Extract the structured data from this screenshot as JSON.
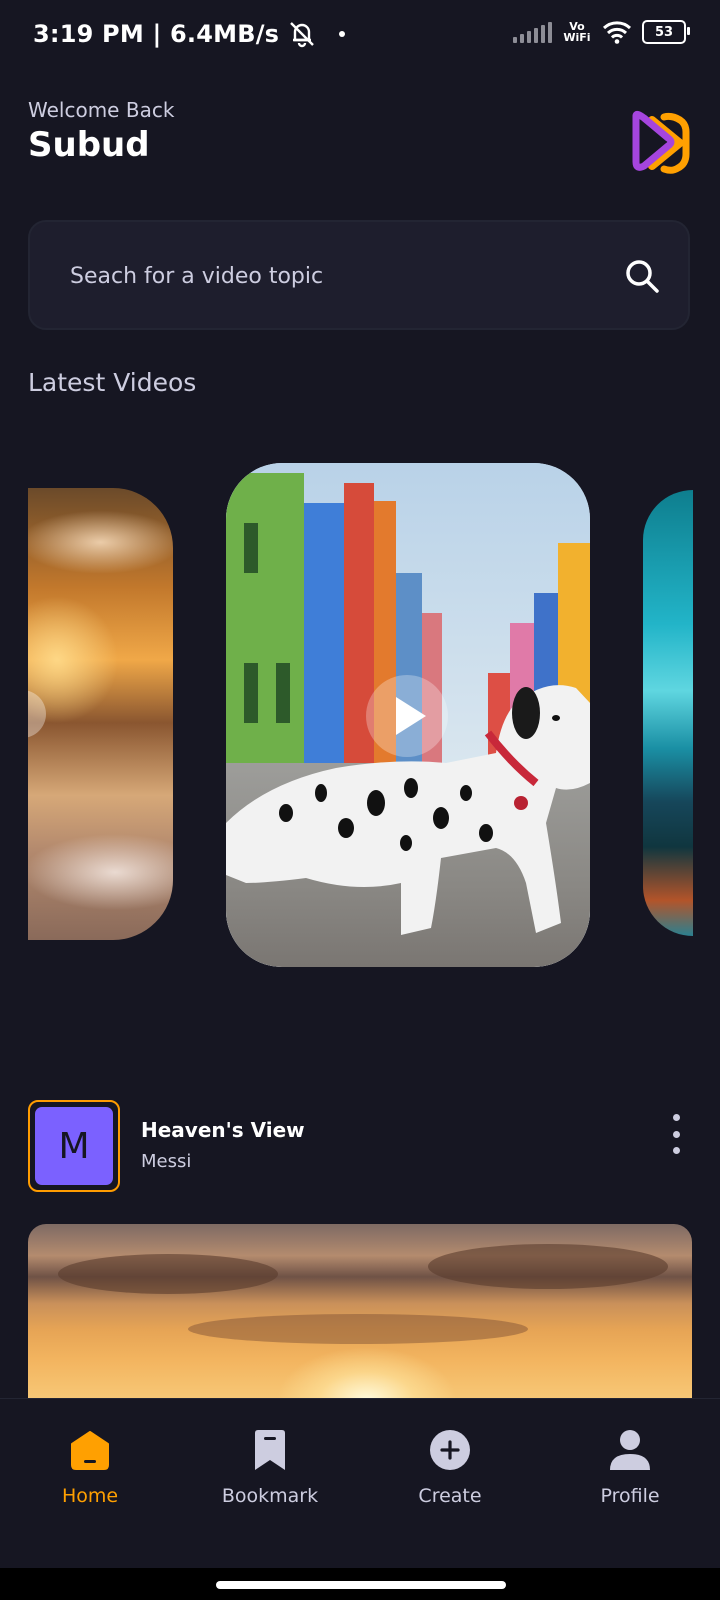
{
  "status_bar": {
    "time_speed": "3:19 PM | 6.4MB/s",
    "network": "Vo WiFi",
    "battery": "53"
  },
  "header": {
    "welcome": "Welcome Back",
    "username": "Subud"
  },
  "search": {
    "placeholder": "Seach for a video topic"
  },
  "latest_videos": {
    "title": "Latest Videos"
  },
  "video_post": {
    "avatar_letter": "M",
    "title": "Heaven's View",
    "creator": "Messi"
  },
  "tabs": [
    {
      "label": "Home",
      "icon": "home-icon",
      "active": true
    },
    {
      "label": "Bookmark",
      "icon": "bookmark-icon",
      "active": false
    },
    {
      "label": "Create",
      "icon": "plus-circle-icon",
      "active": false
    },
    {
      "label": "Profile",
      "icon": "profile-icon",
      "active": false
    }
  ],
  "colors": {
    "background": "#161622",
    "accent": "#ffa001",
    "text_muted": "#cdcde0",
    "avatar": "#7b61ff"
  }
}
